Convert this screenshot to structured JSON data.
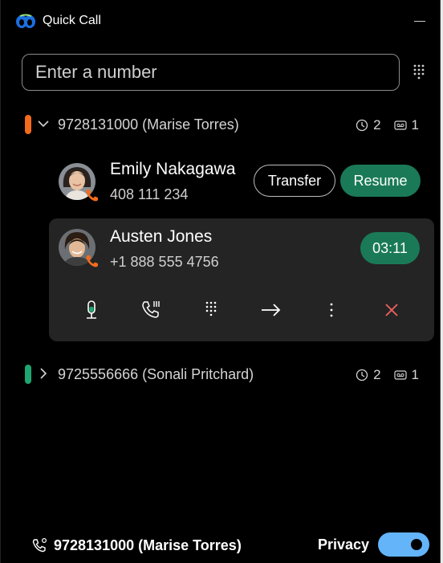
{
  "app": {
    "title": "Quick Call"
  },
  "search": {
    "placeholder": "Enter a number"
  },
  "groups": [
    {
      "label": "9728131000 (Marise Torres)",
      "status_color": "#f26b1d",
      "expanded": true,
      "history_count": "2",
      "voicemail_count": "1"
    },
    {
      "label": "9725556666 (Sonali Pritchard)",
      "status_color": "#1ea672",
      "expanded": false,
      "history_count": "2",
      "voicemail_count": "1"
    }
  ],
  "held_call": {
    "name": "Emily Nakagawa",
    "number": "408 111 234",
    "transfer_label": "Transfer",
    "resume_label": "Resume"
  },
  "active_call": {
    "name": "Austen Jones",
    "number": "+1 888 555 4756",
    "timer": "03:11",
    "controls": [
      "mic-icon",
      "hold-icon",
      "keypad-icon",
      "transfer-arrow-icon",
      "more-options-icon",
      "end-call-icon"
    ]
  },
  "footer": {
    "line_label": "9728131000 (Marise Torres)",
    "privacy_label": "Privacy",
    "privacy_on": true
  },
  "colors": {
    "accent_green": "#1a7a57",
    "status_orange": "#f26b1d",
    "status_green": "#1ea672",
    "toggle_blue": "#64b4fa",
    "end_call_red": "#f0635e"
  }
}
